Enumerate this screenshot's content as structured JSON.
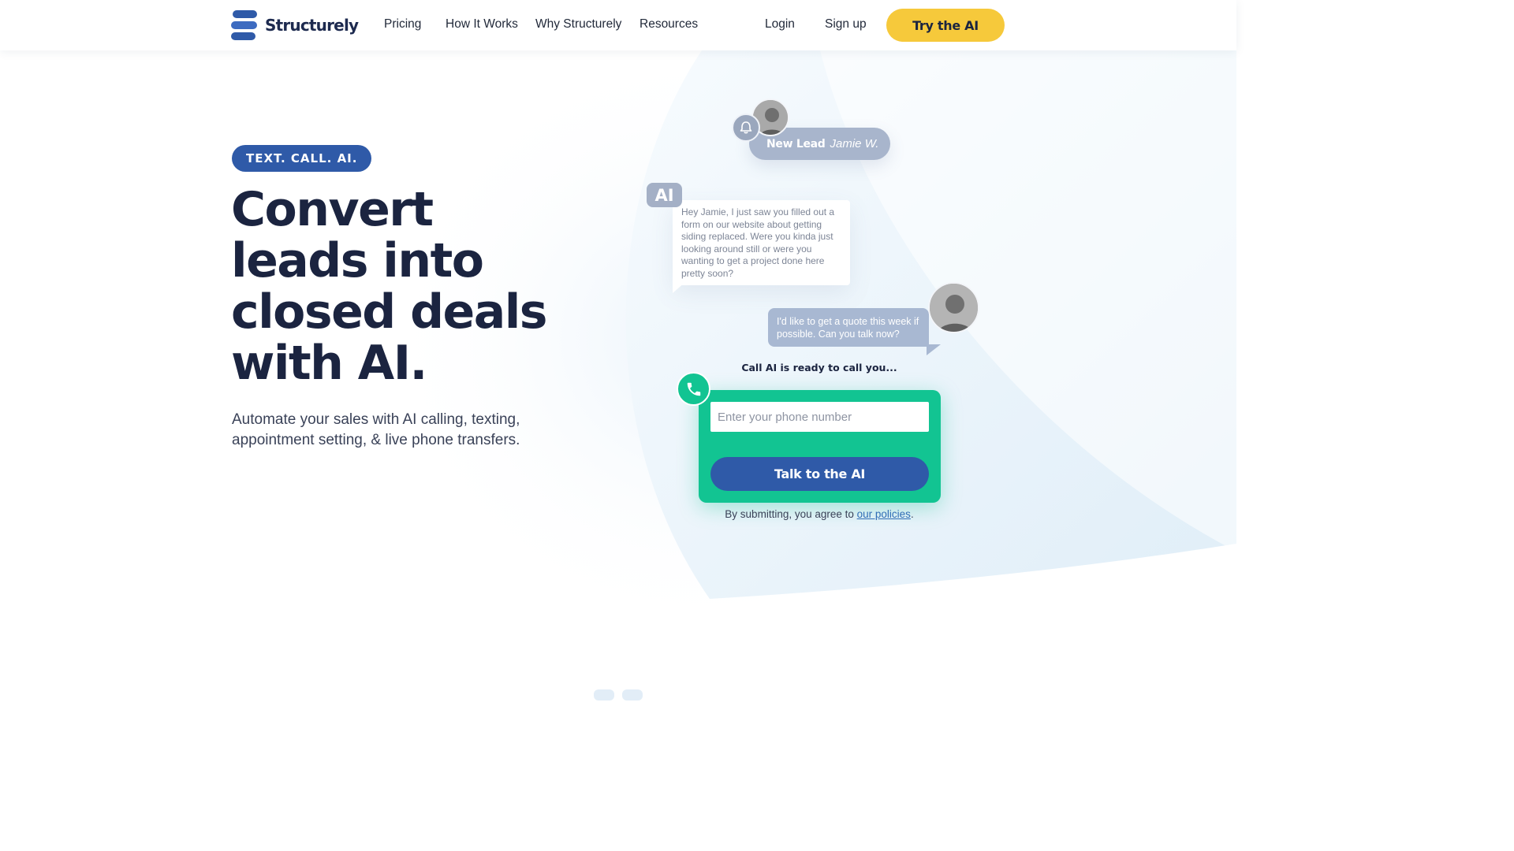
{
  "brand": {
    "name": "Structurely",
    "accent": "#2f5aa8",
    "cta_color": "#f6c93b",
    "success_color": "#12c492",
    "text_dark": "#1b2440"
  },
  "header": {
    "logo_text": "Structurely",
    "nav": [
      "Pricing",
      "How It Works",
      "Why Structurely",
      "Resources"
    ],
    "login": "Login",
    "signup": "Sign up",
    "cta": "Try the AI"
  },
  "hero": {
    "pill": "TEXT. CALL. AI.",
    "headline": [
      "Convert",
      "leads into",
      "closed deals",
      "with AI."
    ],
    "subhead": "Automate your sales with AI calling, texting, appointment setting, & live phone transfers."
  },
  "chat": {
    "lead_label": "New Lead",
    "lead_name": "Jamie W.",
    "ai_tag": "AI",
    "ai_message": "Hey Jamie, I just saw you filled out a form on our website about getting siding replaced. Were you kinda just looking around still or were you wanting to get a project done here pretty soon?",
    "reply_message": "I'd like to get a quote this week if possible. Can you talk now?",
    "call_ready": "Call AI is ready to call you...",
    "icons": {
      "bell": "bell-icon",
      "phone": "phone-icon"
    }
  },
  "form": {
    "phone_placeholder": "Enter your phone number",
    "phone_value": "",
    "submit_label": "Talk to the AI",
    "policy_prefix": "By submitting, you agree to ",
    "policy_link": "our policies",
    "policy_suffix": "."
  }
}
